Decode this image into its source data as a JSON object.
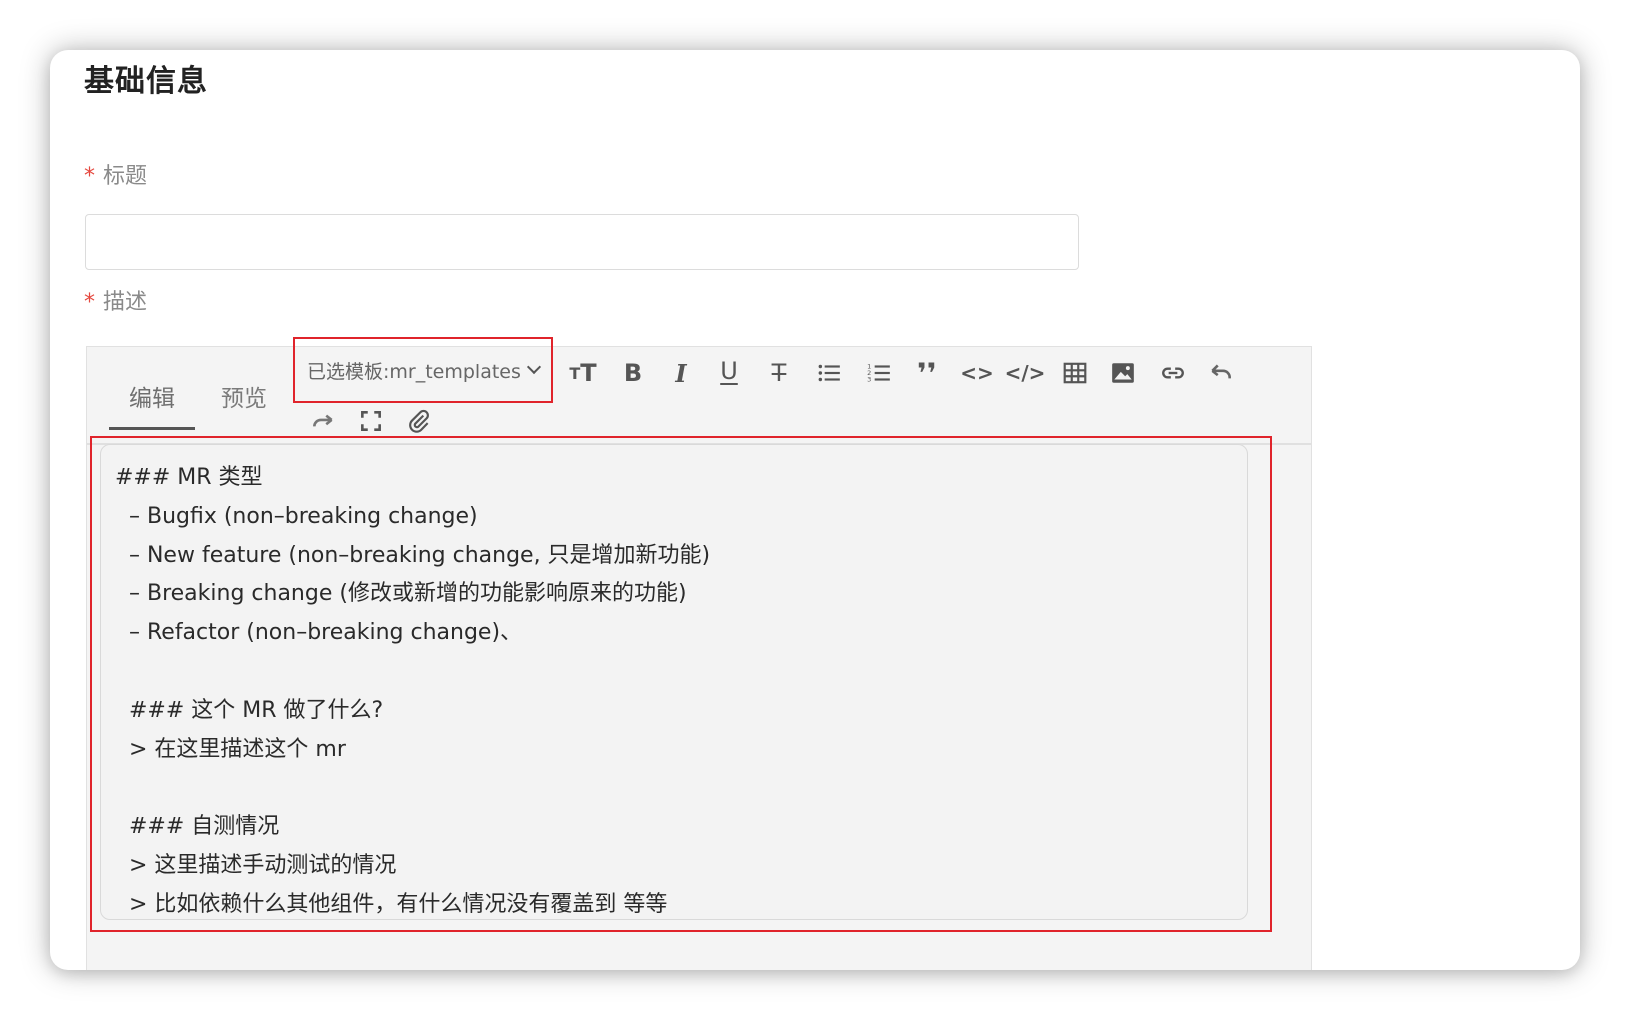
{
  "section": {
    "title": "基础信息"
  },
  "title_field": {
    "required_mark": "*",
    "label": "标题",
    "value": "",
    "placeholder": ""
  },
  "description_field": {
    "required_mark": "*",
    "label": "描述"
  },
  "editor": {
    "tabs": [
      {
        "label": "编辑",
        "active": true
      },
      {
        "label": "预览",
        "active": false
      }
    ],
    "template_select": {
      "selected": "已选模板:mr_templates"
    },
    "toolbar": [
      {
        "name": "heading-icon",
        "glyph": "тT"
      },
      {
        "name": "bold-icon",
        "glyph": "B"
      },
      {
        "name": "italic-icon",
        "glyph": "I"
      },
      {
        "name": "underline-icon",
        "glyph": "U"
      },
      {
        "name": "strikethrough-icon",
        "glyph": "S"
      },
      {
        "name": "bullet-list-icon",
        "glyph": "list"
      },
      {
        "name": "numbered-list-icon",
        "glyph": "olist"
      },
      {
        "name": "quote-icon",
        "glyph": "❜❜"
      },
      {
        "name": "code-inline-icon",
        "glyph": "<>"
      },
      {
        "name": "code-block-icon",
        "glyph": "</>"
      },
      {
        "name": "table-icon",
        "glyph": "table"
      },
      {
        "name": "image-icon",
        "glyph": "image"
      },
      {
        "name": "link-icon",
        "glyph": "link"
      },
      {
        "name": "undo-icon",
        "glyph": "undo"
      },
      {
        "name": "redo-icon",
        "glyph": "redo"
      },
      {
        "name": "fullscreen-icon",
        "glyph": "fullscreen"
      },
      {
        "name": "attachment-icon",
        "glyph": "attach"
      }
    ],
    "content_lines": [
      "### MR 类型",
      "  – Bugfix (non–breaking change)",
      "  – New feature (non–breaking change, 只是增加新功能)",
      "  – Breaking change (修改或新增的功能影响原来的功能)",
      "  – Refactor (non–breaking change)、",
      "",
      "  ### 这个 MR 做了什么?",
      "  > 在这里描述这个 mr",
      "",
      "  ### 自测情况",
      "  > 这里描述手动测试的情况",
      "  > 比如依赖什么其他组件，有什么情况没有覆盖到 等等"
    ]
  },
  "colors": {
    "required": "#e5483f",
    "highlight": "#e0242b"
  }
}
